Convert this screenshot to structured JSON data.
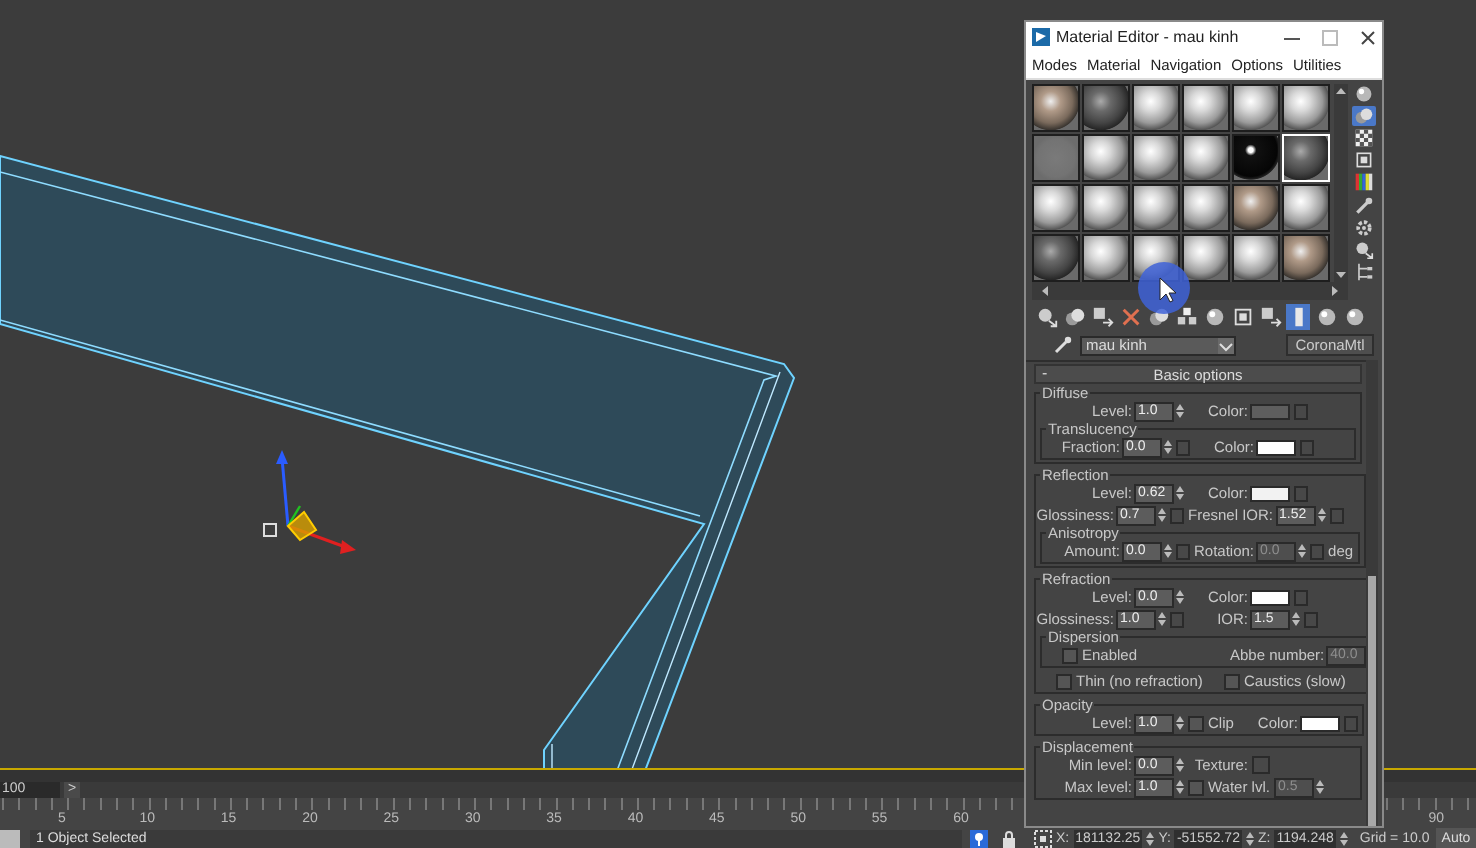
{
  "viewport": {
    "timeline_field": "100",
    "timeline_button": ">",
    "ruler_labels": [
      "5",
      "10",
      "15",
      "20",
      "25",
      "30",
      "35",
      "40",
      "45",
      "50",
      "55",
      "60"
    ],
    "ruler_end_label": "90"
  },
  "status_bar": {
    "message": "1 Object Selected",
    "coords": [
      {
        "label": "X:",
        "value": "181132.25"
      },
      {
        "label": "Y:",
        "value": "-51552.72"
      },
      {
        "label": "Z:",
        "value": "1194.248"
      }
    ],
    "grid": "Grid = 10.0",
    "auto_button": "Auto"
  },
  "material_editor": {
    "title": "Material Editor - mau kinh",
    "menu": [
      "Modes",
      "Material",
      "Navigation",
      "Options",
      "Utilities"
    ],
    "slots": [
      {
        "kind": "textured",
        "selected": false
      },
      {
        "kind": "dark",
        "selected": false
      },
      {
        "kind": "light",
        "selected": false
      },
      {
        "kind": "light",
        "selected": false
      },
      {
        "kind": "light",
        "selected": false
      },
      {
        "kind": "light",
        "selected": false
      },
      {
        "kind": "flat",
        "selected": false
      },
      {
        "kind": "light",
        "selected": false
      },
      {
        "kind": "light",
        "selected": false
      },
      {
        "kind": "light",
        "selected": false
      },
      {
        "kind": "black",
        "selected": false
      },
      {
        "kind": "dark",
        "selected": true
      },
      {
        "kind": "light",
        "selected": false
      },
      {
        "kind": "light",
        "selected": false
      },
      {
        "kind": "light",
        "selected": false
      },
      {
        "kind": "light",
        "selected": false
      },
      {
        "kind": "textured",
        "selected": false
      },
      {
        "kind": "light",
        "selected": false
      },
      {
        "kind": "dark",
        "selected": false
      },
      {
        "kind": "light",
        "selected": false
      },
      {
        "kind": "light",
        "selected": false
      },
      {
        "kind": "light",
        "selected": false
      },
      {
        "kind": "light",
        "selected": false
      },
      {
        "kind": "textured",
        "selected": false
      }
    ],
    "side_tools": [
      {
        "kind": "sphere",
        "on": false
      },
      {
        "kind": "sphere-pair",
        "on": true
      },
      {
        "kind": "checker",
        "on": false
      },
      {
        "kind": "square",
        "on": false
      },
      {
        "kind": "color-bars",
        "on": false
      },
      {
        "kind": "wrench",
        "on": false
      },
      {
        "kind": "gear",
        "on": false
      },
      {
        "kind": "sphere-arrow",
        "on": false
      },
      {
        "kind": "tree",
        "on": false
      }
    ],
    "toolbar": [
      {
        "kind": "sphere-arrow",
        "on": false
      },
      {
        "kind": "sphere-pair",
        "on": false
      },
      {
        "kind": "square-arrow",
        "on": false
      },
      {
        "kind": "x",
        "on": false
      },
      {
        "kind": "sphere-pair",
        "on": false
      },
      {
        "kind": "cubes",
        "on": false
      },
      {
        "kind": "sphere",
        "on": false
      },
      {
        "kind": "square",
        "on": false
      },
      {
        "kind": "square-arrow",
        "on": false
      },
      {
        "kind": "bar",
        "on": true
      },
      {
        "kind": "sphere",
        "on": false
      },
      {
        "kind": "sphere",
        "on": false
      }
    ],
    "material_name": "mau kinh",
    "material_type": "CoronaMtl",
    "rollout": {
      "collapse": "-",
      "title": "Basic options",
      "sections": [
        {
          "title": "Diffuse",
          "items": [
            {
              "kind": "row",
              "controls": [
                {
                  "kind": "spinner",
                  "label": "Level:",
                  "value": "1.0",
                  "map": false,
                  "disabled": false
                },
                {
                  "kind": "color",
                  "label": "Color:",
                  "color": "#5e5e5e"
                }
              ]
            },
            {
              "kind": "group",
              "title": "Translucency",
              "items": [
                {
                  "kind": "row",
                  "controls": [
                    {
                      "kind": "spinner",
                      "label": "Fraction:",
                      "value": "0.0",
                      "map": true,
                      "disabled": false
                    },
                    {
                      "kind": "color",
                      "label": "Color:",
                      "color": "#ffffff"
                    }
                  ]
                }
              ]
            }
          ]
        },
        {
          "title": "Reflection",
          "items": [
            {
              "kind": "row",
              "controls": [
                {
                  "kind": "spinner",
                  "label": "Level:",
                  "value": "0.62",
                  "map": false,
                  "disabled": false
                },
                {
                  "kind": "color",
                  "label": "Color:",
                  "color": "#f2f2f2"
                }
              ]
            },
            {
              "kind": "row",
              "controls": [
                {
                  "kind": "spinner",
                  "label": "Glossiness:",
                  "value": "0.7",
                  "map": true,
                  "disabled": false
                },
                {
                  "kind": "spinner",
                  "label": "Fresnel IOR:",
                  "value": "1.52",
                  "map": true,
                  "disabled": false
                }
              ]
            },
            {
              "kind": "group",
              "title": "Anisotropy",
              "items": [
                {
                  "kind": "row",
                  "controls": [
                    {
                      "kind": "spinner",
                      "label": "Amount:",
                      "value": "0.0",
                      "map": true,
                      "disabled": false
                    },
                    {
                      "kind": "spinner",
                      "label": "Rotation:",
                      "value": "0.0",
                      "map": true,
                      "disabled": true
                    },
                    {
                      "kind": "text",
                      "text": "deg"
                    }
                  ]
                }
              ]
            }
          ]
        },
        {
          "title": "Refraction",
          "items": [
            {
              "kind": "row",
              "controls": [
                {
                  "kind": "spinner",
                  "label": "Level:",
                  "value": "0.0",
                  "map": false,
                  "disabled": false
                },
                {
                  "kind": "color",
                  "label": "Color:",
                  "color": "#ffffff"
                }
              ]
            },
            {
              "kind": "row",
              "controls": [
                {
                  "kind": "spinner",
                  "label": "Glossiness:",
                  "value": "1.0",
                  "map": true,
                  "disabled": false
                },
                {
                  "kind": "spinner",
                  "label": "IOR:",
                  "value": "1.5",
                  "map": true,
                  "disabled": false
                }
              ]
            },
            {
              "kind": "group",
              "title": "Dispersion",
              "items": [
                {
                  "kind": "row",
                  "controls": [
                    {
                      "kind": "checkbox",
                      "label": "Enabled",
                      "checked": false
                    },
                    {
                      "kind": "spinner",
                      "label": "Abbe number:",
                      "value": "40.0",
                      "map": false,
                      "disabled": true
                    }
                  ]
                }
              ]
            },
            {
              "kind": "row",
              "controls": [
                {
                  "kind": "checkbox",
                  "label": "Thin (no refraction)",
                  "checked": false
                },
                {
                  "kind": "checkbox",
                  "label": "Caustics (slow)",
                  "checked": false
                }
              ]
            }
          ]
        },
        {
          "title": "Opacity",
          "items": [
            {
              "kind": "row",
              "controls": [
                {
                  "kind": "spinner",
                  "label": "Level:",
                  "value": "1.0",
                  "map": false,
                  "disabled": false
                },
                {
                  "kind": "checkbox",
                  "label": "Clip",
                  "checked": false
                },
                {
                  "kind": "color",
                  "label": "Color:",
                  "color": "#ffffff"
                }
              ]
            }
          ]
        },
        {
          "title": "Displacement",
          "items": [
            {
              "kind": "row",
              "controls": [
                {
                  "kind": "spinner",
                  "label": "Min level:",
                  "value": "0.0",
                  "map": false,
                  "disabled": false
                },
                {
                  "kind": "map",
                  "label": "Texture:"
                }
              ]
            },
            {
              "kind": "row",
              "controls": [
                {
                  "kind": "spinner",
                  "label": "Max level:",
                  "value": "1.0",
                  "map": false,
                  "disabled": false
                },
                {
                  "kind": "checkbox",
                  "label": "Water lvl.",
                  "checked": false
                },
                {
                  "kind": "spinner",
                  "value": "0.5",
                  "map": false,
                  "disabled": true
                }
              ]
            }
          ]
        }
      ]
    }
  }
}
